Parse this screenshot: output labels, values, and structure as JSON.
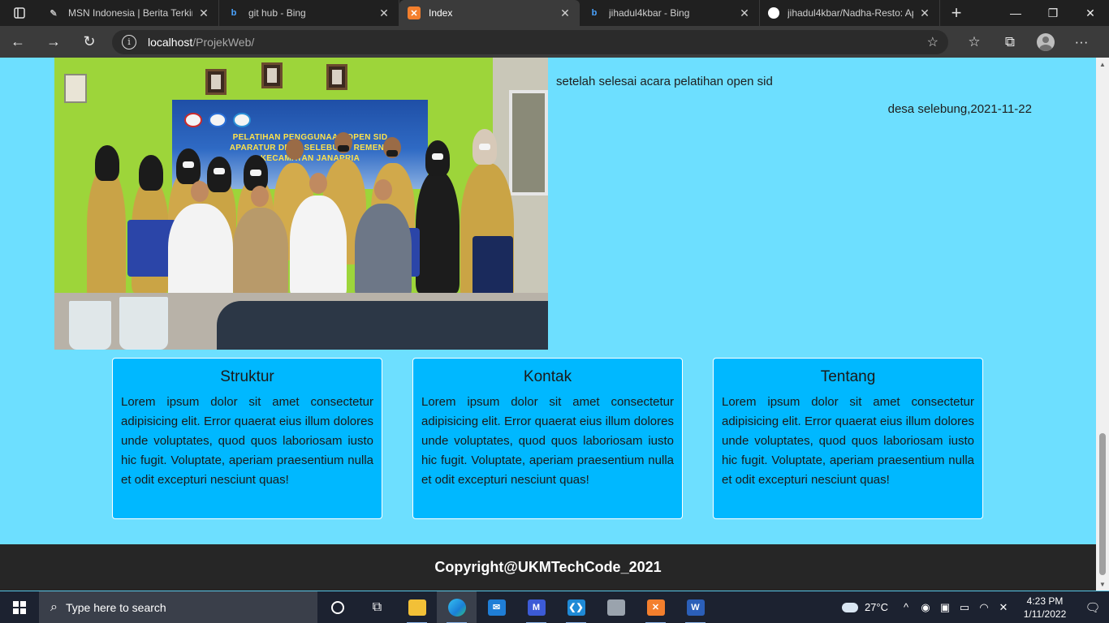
{
  "browser": {
    "tabs": [
      {
        "title": "MSN Indonesia | Berita Terkini",
        "favicon": "msn-icon",
        "active": false
      },
      {
        "title": "git hub - Bing",
        "favicon": "bing-icon",
        "active": false
      },
      {
        "title": "Index",
        "favicon": "xampp-icon",
        "active": true
      },
      {
        "title": "jihadul4kbar - Bing",
        "favicon": "bing-icon",
        "active": false
      },
      {
        "title": "jihadul4kbar/Nadha-Resto: Ap",
        "favicon": "github-icon",
        "active": false
      }
    ],
    "address": {
      "host": "localhost",
      "path": "/ProjekWeb/"
    }
  },
  "page": {
    "caption": {
      "description": "setelah selesai acara pelatihan open sid",
      "date_line": "desa selebung,2021-11-22"
    },
    "photo": {
      "banner_line_1": "PELATIHAN PENGGUNAAN OPEN SID",
      "banner_line_2": "APARATUR DESA SELEBUNG REMENG",
      "banner_line_3": "KECAMATAN JANAPRIA"
    },
    "cards": [
      {
        "title": "Struktur",
        "body": "Lorem ipsum dolor sit amet consectetur adipisicing elit. Error quaerat eius illum dolores unde voluptates, quod quos laboriosam iusto hic fugit. Voluptate, aperiam praesentium nulla et odit excepturi nesciunt quas!"
      },
      {
        "title": "Kontak",
        "body": "Lorem ipsum dolor sit amet consectetur adipisicing elit. Error quaerat eius illum dolores unde voluptates, quod quos laboriosam iusto hic fugit. Voluptate, aperiam praesentium nulla et odit excepturi nesciunt quas!"
      },
      {
        "title": "Tentang",
        "body": "Lorem ipsum dolor sit amet consectetur adipisicing elit. Error quaerat eius illum dolores unde voluptates, quod quos laboriosam iusto hic fugit. Voluptate, aperiam praesentium nulla et odit excepturi nesciunt quas!"
      }
    ],
    "footer": "Copyright@UKMTechCode_2021"
  },
  "taskbar": {
    "search_placeholder": "Type here to search",
    "temperature": "27°C",
    "time": "4:23 PM",
    "date": "1/11/2022",
    "apps": [
      "task-view-icon",
      "widgets-icon",
      "file-explorer-icon",
      "edge-icon",
      "mail-icon",
      "photos-icon",
      "vscode-icon",
      "remote-desktop-icon",
      "xampp-icon",
      "word-icon"
    ]
  },
  "colors": {
    "page_bg": "#6ddfff",
    "card_bg": "#00b8ff",
    "footer_bg": "#262626"
  }
}
